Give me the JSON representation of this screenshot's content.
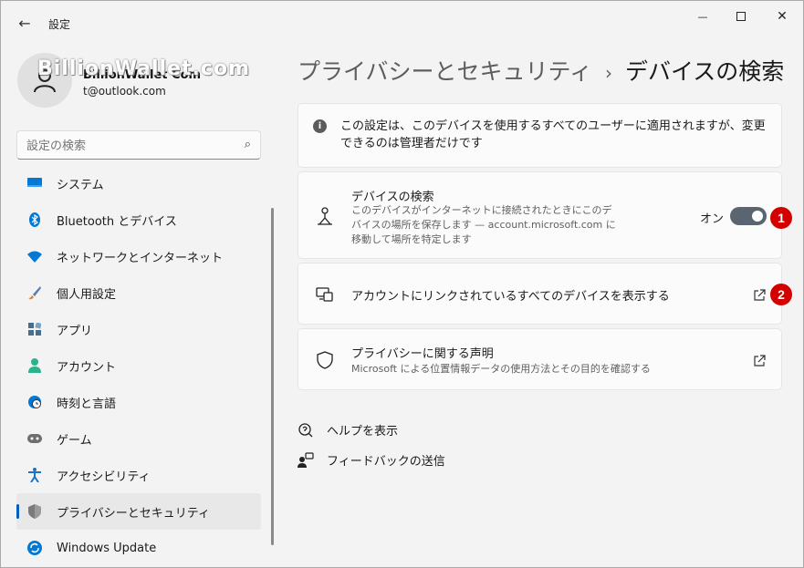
{
  "window": {
    "title": "設定",
    "back_glyph": "←",
    "minimize_glyph": "—",
    "close_glyph": "✕"
  },
  "account": {
    "name": "BillionWallet Com",
    "email": "t@outlook.com",
    "watermark": "BillionWallet.com"
  },
  "search": {
    "placeholder": "設定の検索",
    "icon": "search-icon"
  },
  "sidebar": {
    "items": [
      {
        "label": "システム",
        "icon": "monitor-icon",
        "color": "#0078d4"
      },
      {
        "label": "Bluetooth とデバイス",
        "icon": "bluetooth-icon",
        "color": "#0078d4"
      },
      {
        "label": "ネットワークとインターネット",
        "icon": "wifi-icon",
        "color": "#0078d4"
      },
      {
        "label": "個人用設定",
        "icon": "brush-icon",
        "color": "#e08a2b"
      },
      {
        "label": "アプリ",
        "icon": "apps-icon",
        "color": "#4a6d8c"
      },
      {
        "label": "アカウント",
        "icon": "person-icon",
        "color": "#2bb38c"
      },
      {
        "label": "時刻と言語",
        "icon": "clock-globe-icon",
        "color": "#0078d4"
      },
      {
        "label": "ゲーム",
        "icon": "gamepad-icon",
        "color": "#6e6e6e"
      },
      {
        "label": "アクセシビリティ",
        "icon": "accessibility-icon",
        "color": "#1a73c8"
      },
      {
        "label": "プライバシーとセキュリティ",
        "icon": "shield-icon",
        "color": "#6e6e6e",
        "active": true
      },
      {
        "label": "Windows Update",
        "icon": "update-icon",
        "color": "#0078d4"
      }
    ]
  },
  "breadcrumb": {
    "parent": "プライバシーとセキュリティ",
    "separator": "›",
    "current": "デバイスの検索"
  },
  "info": {
    "text": "この設定は、このデバイスを使用するすべてのユーザーに適用されますが、変更できるのは管理者だけです"
  },
  "find_device": {
    "title": "デバイスの検索",
    "description": "このデバイスがインターネットに接続されたときにこのデバイスの場所を保存します — account.microsoft.com に移動して場所を特定します",
    "toggle_label": "オン",
    "toggle_on": true
  },
  "linked_devices": {
    "title": "アカウントにリンクされているすべてのデバイスを表示する"
  },
  "privacy_statement": {
    "title": "プライバシーに関する声明",
    "description": "Microsoft による位置情報データの使用方法とその目的を確認する"
  },
  "badges": {
    "one": "1",
    "two": "2",
    "color": "#d40000"
  },
  "footer": {
    "help": "ヘルプを表示",
    "feedback": "フィードバックの送信"
  },
  "colors": {
    "accent": "#005fb8",
    "toggle": "#5a6571"
  }
}
